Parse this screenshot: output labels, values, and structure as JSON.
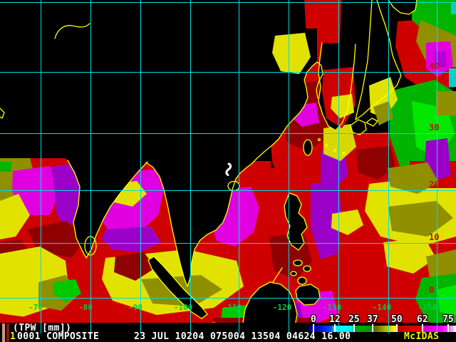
{
  "annotation": {
    "parameter_label": "(TPW [mm])",
    "frame_number": "1",
    "frame_id": "0001 COMPOSITE",
    "timestamp": "23 JUL 10204 075004 13504 04624 16.00",
    "brand": "McIDAS"
  },
  "colorbar": {
    "tick_labels": [
      "0",
      "12",
      "25",
      "37",
      "50",
      "62",
      "75"
    ],
    "scale_colors": [
      "#000000",
      "#0000ee",
      "#00ffff",
      "#00aa00",
      "#ffff00",
      "#dd0000",
      "#ff00ff",
      "#ffffff"
    ]
  },
  "grid": {
    "longitude_labels": [
      "-70",
      "-80",
      "-90",
      "-100",
      "-110",
      "-120",
      "-130",
      "-140",
      "-150"
    ],
    "latitude_labels": [
      "40",
      "30",
      "20",
      "10",
      "0"
    ],
    "line_color": "#00dede"
  },
  "map": {
    "storm_marker": "tropical-cyclone-symbol",
    "coastline_color": "#ffff00",
    "no_data_color": "#000000"
  },
  "colors": {
    "lon_label": "#00cc44",
    "lat_label": "#bb1500",
    "annotation_text": "#ffffff",
    "annotation_accent": "#f2f200",
    "swatch_left": "#cc9977",
    "swatch_right": "#7a1a1a"
  }
}
